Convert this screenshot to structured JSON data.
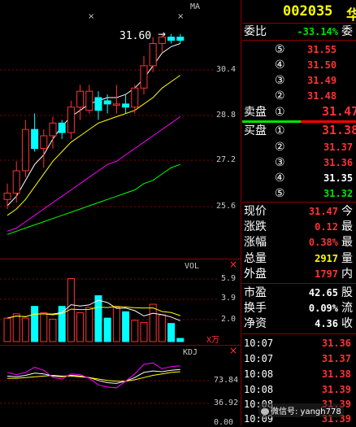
{
  "colors": {
    "up": "#ff3232",
    "down": "#00ffff",
    "panel_border": "#8b0000",
    "ma_white": "#ffffff",
    "ma_yellow": "#ffff00",
    "ma_magenta": "#ff00ff",
    "ma_green": "#00ff00"
  },
  "chart": {
    "ma_label": "MA",
    "price_annotation": "31.60",
    "price_axis": [
      "30.4",
      "28.8",
      "27.2",
      "25.6"
    ],
    "vol_label": "VOL",
    "vol_axis": [
      "5.9",
      "3.9",
      "2.0"
    ],
    "vol_unit": "X万",
    "kdj_label": "KDJ",
    "kdj_axis": [
      "73.84",
      "36.92",
      "0.00"
    ]
  },
  "chart_data": {
    "type": "candlestick",
    "candles": [
      {
        "o": 26.4,
        "h": 26.9,
        "l": 26.1,
        "c": 26.6,
        "up": true
      },
      {
        "o": 26.6,
        "h": 27.6,
        "l": 26.3,
        "c": 27.3,
        "up": true
      },
      {
        "o": 27.3,
        "h": 28.9,
        "l": 27.1,
        "c": 28.6,
        "up": true
      },
      {
        "o": 28.6,
        "h": 29.1,
        "l": 27.9,
        "c": 28.0,
        "up": false
      },
      {
        "o": 28.0,
        "h": 28.6,
        "l": 27.4,
        "c": 28.4,
        "up": true
      },
      {
        "o": 28.4,
        "h": 29.0,
        "l": 28.0,
        "c": 28.8,
        "up": true
      },
      {
        "o": 28.8,
        "h": 28.9,
        "l": 28.3,
        "c": 28.5,
        "up": false
      },
      {
        "o": 28.5,
        "h": 29.5,
        "l": 28.3,
        "c": 29.3,
        "up": true
      },
      {
        "o": 29.3,
        "h": 30.0,
        "l": 28.9,
        "c": 29.8,
        "up": true
      },
      {
        "o": 29.8,
        "h": 30.0,
        "l": 29.1,
        "c": 29.2,
        "up": true
      },
      {
        "o": 29.2,
        "h": 29.8,
        "l": 28.9,
        "c": 29.6,
        "up": false
      },
      {
        "o": 29.4,
        "h": 29.7,
        "l": 29.1,
        "c": 29.5,
        "up": false
      },
      {
        "o": 29.4,
        "h": 30.0,
        "l": 29.1,
        "c": 29.4,
        "up": true
      },
      {
        "o": 29.4,
        "h": 29.7,
        "l": 29.1,
        "c": 29.3,
        "up": false
      },
      {
        "o": 29.3,
        "h": 30.0,
        "l": 29.1,
        "c": 29.9,
        "up": true
      },
      {
        "o": 29.9,
        "h": 30.9,
        "l": 29.7,
        "c": 30.6,
        "up": true
      },
      {
        "o": 30.6,
        "h": 31.5,
        "l": 30.4,
        "c": 31.3,
        "up": true
      },
      {
        "o": 31.3,
        "h": 31.6,
        "l": 31.0,
        "c": 31.5,
        "up": true
      },
      {
        "o": 31.5,
        "h": 31.6,
        "l": 31.3,
        "c": 31.4,
        "up": false
      },
      {
        "o": 31.4,
        "h": 31.6,
        "l": 31.3,
        "c": 31.5,
        "up": false
      }
    ],
    "ma_white": [
      26.2,
      26.5,
      27.0,
      27.5,
      27.8,
      28.3,
      28.7,
      29.0,
      29.2,
      29.4,
      29.5,
      29.6,
      29.6,
      29.7,
      29.9,
      30.2,
      30.6,
      31.0,
      31.2,
      31.3
    ],
    "ma_yellow": [
      25.9,
      26.1,
      26.4,
      26.8,
      27.2,
      27.6,
      27.9,
      28.2,
      28.4,
      28.6,
      28.8,
      28.9,
      29.0,
      29.1,
      29.2,
      29.4,
      29.6,
      29.9,
      30.1,
      30.3
    ],
    "ma_magenta": [
      25.4,
      25.5,
      25.7,
      25.9,
      26.1,
      26.3,
      26.5,
      26.7,
      26.9,
      27.1,
      27.3,
      27.5,
      27.6,
      27.8,
      28.0,
      28.2,
      28.4,
      28.6,
      28.8,
      29.0
    ],
    "ma_green": [
      25.3,
      25.4,
      25.5,
      25.6,
      25.7,
      25.8,
      25.9,
      26.0,
      26.1,
      26.2,
      26.3,
      26.4,
      26.5,
      26.6,
      26.7,
      26.9,
      27.0,
      27.2,
      27.4,
      27.5
    ],
    "price_range": [
      25.0,
      31.9
    ],
    "volumes": [
      2.2,
      2.6,
      2.2,
      3.3,
      2.7,
      2.1,
      3.3,
      5.9,
      2.7,
      3.2,
      4.3,
      2.2,
      3.2,
      2.8,
      2.0,
      1.8,
      3.5,
      2.5,
      1.7,
      0.3
    ],
    "vol_range": [
      0,
      6.4
    ],
    "kdj_k": [
      64,
      63,
      65,
      68,
      67,
      64,
      63,
      65,
      64,
      62,
      58,
      55,
      54,
      57,
      62,
      69,
      71,
      70,
      72,
      73
    ],
    "kdj_d": [
      61,
      61,
      62,
      63,
      64,
      65,
      64,
      64,
      63,
      62,
      60,
      58,
      57,
      57,
      59,
      62,
      65,
      67,
      69,
      70
    ],
    "kdj_j": [
      69,
      66,
      69,
      76,
      72,
      62,
      60,
      67,
      66,
      61,
      52,
      49,
      48,
      57,
      67,
      80,
      82,
      74,
      77,
      78
    ],
    "kdj_range": [
      0,
      100
    ]
  },
  "quote": {
    "code": "002035",
    "name_partial": "华",
    "webi_label": "委比",
    "webi_value": "-33.14%",
    "webi_cut": "委",
    "sell_header": "卖盘",
    "buy_header": "买盘",
    "sell_levels": [
      {
        "n": "⑤",
        "price": "31.55"
      },
      {
        "n": "④",
        "price": "31.50"
      },
      {
        "n": "③",
        "price": "31.49"
      },
      {
        "n": "②",
        "price": "31.48"
      },
      {
        "n": "①",
        "price": "31.47"
      }
    ],
    "buy_levels": [
      {
        "n": "①",
        "price": "31.38"
      },
      {
        "n": "②",
        "price": "31.37"
      },
      {
        "n": "③",
        "price": "31.36"
      },
      {
        "n": "④",
        "price": "31.35"
      },
      {
        "n": "⑤",
        "price": "31.32"
      }
    ],
    "stats": [
      {
        "label": "现价",
        "value": "31.47",
        "cut": "今"
      },
      {
        "label": "涨跌",
        "value": "0.12",
        "cut": "最"
      },
      {
        "label": "涨幅",
        "value": "0.38%",
        "cut": "最"
      },
      {
        "label": "总量",
        "value": "2917",
        "cut": "量"
      },
      {
        "label": "外盘",
        "value": "1797",
        "cut": "内"
      }
    ],
    "stats2": [
      {
        "label": "市盈",
        "value": "42.65",
        "cut": "股"
      },
      {
        "label": "换手",
        "value": "0.09%",
        "cut": "流"
      },
      {
        "label": "净资",
        "value": "4.36",
        "cut": "收"
      }
    ],
    "ticks": [
      {
        "time": "10:07",
        "price": "31.36"
      },
      {
        "time": "10:07",
        "price": "31.37"
      },
      {
        "time": "10:08",
        "price": "31.38"
      },
      {
        "time": "10:08",
        "price": "31.39"
      },
      {
        "time": "10:08",
        "price": "31.39"
      },
      {
        "time": "10:09",
        "price": "31.39"
      }
    ]
  },
  "watermark": "微信号: yangh778"
}
